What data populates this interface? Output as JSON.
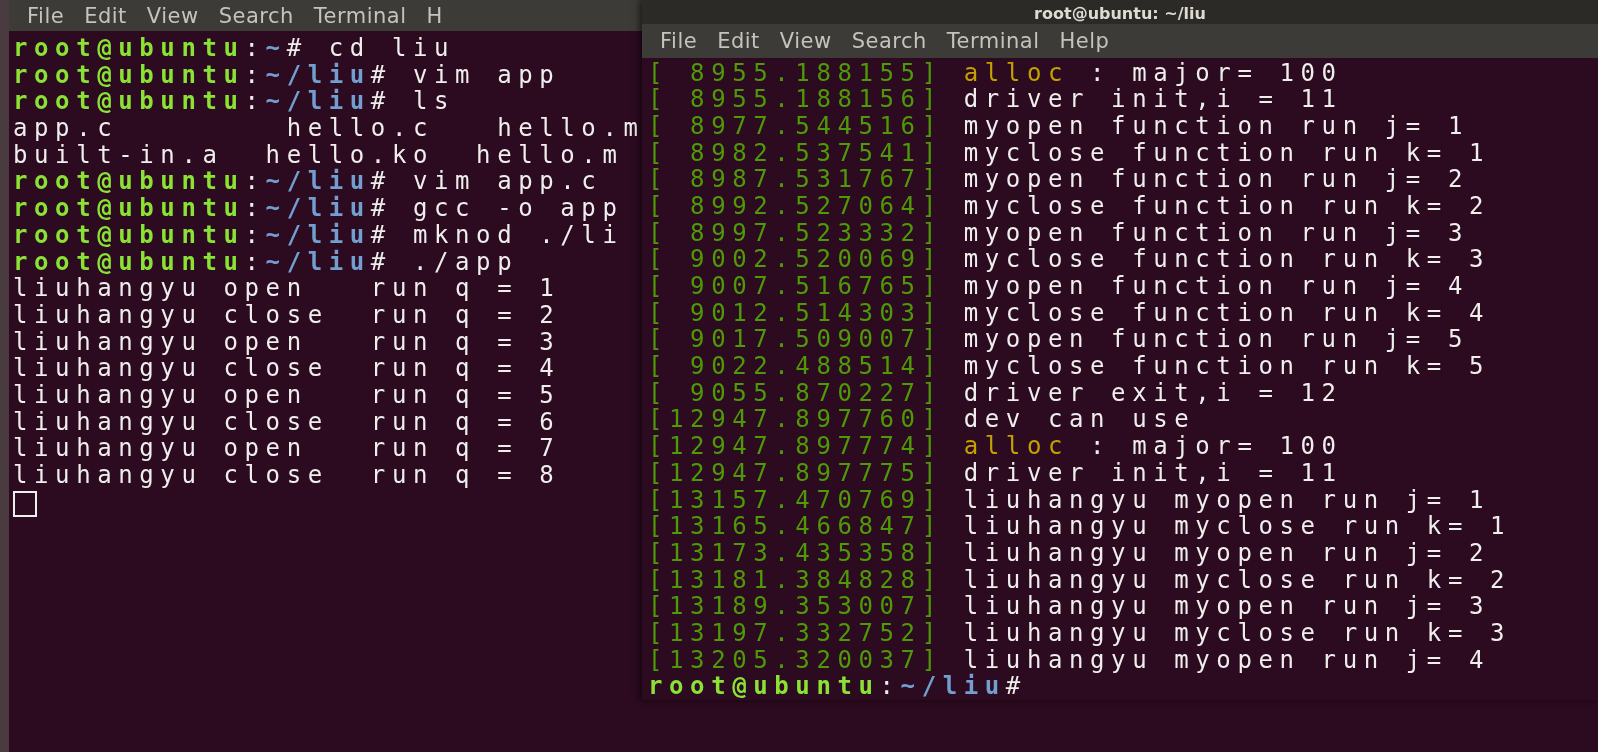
{
  "left_terminal": {
    "menu": [
      "File",
      "Edit",
      "View",
      "Search",
      "Terminal",
      "H"
    ],
    "lines": [
      {
        "kind": "prompt",
        "user_host": "root@ubuntu",
        "separator": ":",
        "path": "~",
        "command": "# cd liu"
      },
      {
        "kind": "prompt",
        "user_host": "root@ubuntu",
        "separator": ":",
        "path": "~/liu",
        "command": "# vim app"
      },
      {
        "kind": "prompt",
        "user_host": "root@ubuntu",
        "separator": ":",
        "path": "~/liu",
        "command": "# ls"
      },
      {
        "kind": "output",
        "text": "app.c        hello.c   hello.m"
      },
      {
        "kind": "output",
        "text": "built-in.a  hello.ko  hello.m"
      },
      {
        "kind": "prompt",
        "user_host": "root@ubuntu",
        "separator": ":",
        "path": "~/liu",
        "command": "# vim app.c"
      },
      {
        "kind": "prompt",
        "user_host": "root@ubuntu",
        "separator": ":",
        "path": "~/liu",
        "command": "# gcc -o app"
      },
      {
        "kind": "prompt",
        "user_host": "root@ubuntu",
        "separator": ":",
        "path": "~/liu",
        "command": "# mknod ./li"
      },
      {
        "kind": "prompt",
        "user_host": "root@ubuntu",
        "separator": ":",
        "path": "~/liu",
        "command": "# ./app"
      },
      {
        "kind": "output",
        "text": "liuhangyu open   run q = 1"
      },
      {
        "kind": "output",
        "text": "liuhangyu close  run q = 2"
      },
      {
        "kind": "output",
        "text": "liuhangyu open   run q = 3"
      },
      {
        "kind": "output",
        "text": "liuhangyu close  run q = 4"
      },
      {
        "kind": "output",
        "text": "liuhangyu open   run q = 5"
      },
      {
        "kind": "output",
        "text": "liuhangyu close  run q = 6"
      },
      {
        "kind": "output",
        "text": "liuhangyu open   run q = 7"
      },
      {
        "kind": "output",
        "text": "liuhangyu close  run q = 8"
      }
    ],
    "cursor": {
      "focused": false
    }
  },
  "right_terminal": {
    "title": "root@ubuntu: ~/liu",
    "menu": [
      "File",
      "Edit",
      "View",
      "Search",
      "Terminal",
      "Help"
    ],
    "lines": [
      {
        "timestamp": "[ 8955.188155]",
        "keyword": "alloc",
        "text": ": major= 100"
      },
      {
        "timestamp": "[ 8955.188156]",
        "text": "driver init,i = 11"
      },
      {
        "timestamp": "[ 8977.544516]",
        "text": "myopen function run j= 1"
      },
      {
        "timestamp": "[ 8982.537541]",
        "text": "myclose function run k= 1"
      },
      {
        "timestamp": "[ 8987.531767]",
        "text": "myopen function run j= 2"
      },
      {
        "timestamp": "[ 8992.527064]",
        "text": "myclose function run k= 2"
      },
      {
        "timestamp": "[ 8997.523332]",
        "text": "myopen function run j= 3"
      },
      {
        "timestamp": "[ 9002.520069]",
        "text": "myclose function run k= 3"
      },
      {
        "timestamp": "[ 9007.516765]",
        "text": "myopen function run j= 4"
      },
      {
        "timestamp": "[ 9012.514303]",
        "text": "myclose function run k= 4"
      },
      {
        "timestamp": "[ 9017.509007]",
        "text": "myopen function run j= 5"
      },
      {
        "timestamp": "[ 9022.488514]",
        "text": "myclose function run k= 5"
      },
      {
        "timestamp": "[ 9055.870227]",
        "text": "driver exit,i = 12"
      },
      {
        "timestamp": "[12947.897760]",
        "text": "dev can use"
      },
      {
        "timestamp": "[12947.897774]",
        "keyword": "alloc",
        "text": ": major= 100"
      },
      {
        "timestamp": "[12947.897775]",
        "text": "driver init,i = 11"
      },
      {
        "timestamp": "[13157.470769]",
        "text": "liuhangyu myopen run j= 1"
      },
      {
        "timestamp": "[13165.466847]",
        "text": "liuhangyu myclose run k= 1"
      },
      {
        "timestamp": "[13173.435358]",
        "text": "liuhangyu myopen run j= 2"
      },
      {
        "timestamp": "[13181.384828]",
        "text": "liuhangyu myclose run k= 2"
      },
      {
        "timestamp": "[13189.353007]",
        "text": "liuhangyu myopen run j= 3"
      },
      {
        "timestamp": "[13197.332752]",
        "text": "liuhangyu myclose run k= 3"
      },
      {
        "timestamp": "[13205.320037]",
        "text": "liuhangyu myopen run j= 4"
      }
    ],
    "prompt": {
      "user_host": "root@ubuntu",
      "separator": ":",
      "path": "~/liu",
      "command": "#"
    }
  }
}
